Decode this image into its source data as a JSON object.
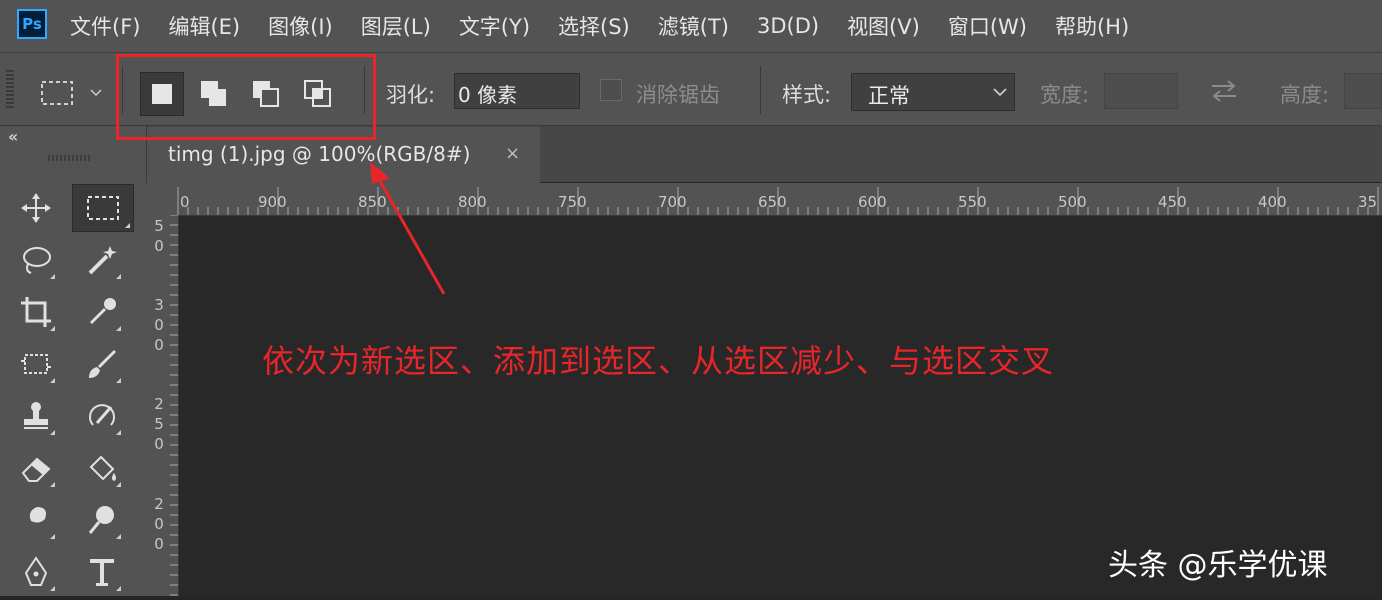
{
  "app": {
    "logo_text": "Ps"
  },
  "menu": [
    "文件(F)",
    "编辑(E)",
    "图像(I)",
    "图层(L)",
    "文字(Y)",
    "选择(S)",
    "滤镜(T)",
    "3D(D)",
    "视图(V)",
    "窗口(W)",
    "帮助(H)"
  ],
  "options": {
    "feather_label": "羽化:",
    "feather_value": "0 像素",
    "antialias_label": "消除锯齿",
    "style_label": "样式:",
    "style_value": "正常",
    "width_label": "宽度:",
    "height_label": "高度:"
  },
  "document_tab": {
    "title": "timg (1).jpg @ 100%(RGB/8#)",
    "close": "×"
  },
  "ruler": {
    "horizontal": [
      "0",
      "900",
      "850",
      "800",
      "750",
      "700",
      "650",
      "600",
      "550",
      "500",
      "450",
      "400",
      "35"
    ],
    "vertical": [
      [
        "5",
        "0"
      ],
      [
        "3",
        "0",
        "0"
      ],
      [
        "2",
        "5",
        "0"
      ],
      [
        "2",
        "0",
        "0"
      ]
    ]
  },
  "annotation": {
    "text": "依次为新选区、添加到选区、从选区减少、与选区交叉",
    "color": "#e8262a"
  },
  "watermark": "头条 @乐学优课",
  "colors": {
    "accent": "#31a8ff",
    "panel": "#535353",
    "canvas": "#282828",
    "highlight": "#e8262a"
  }
}
